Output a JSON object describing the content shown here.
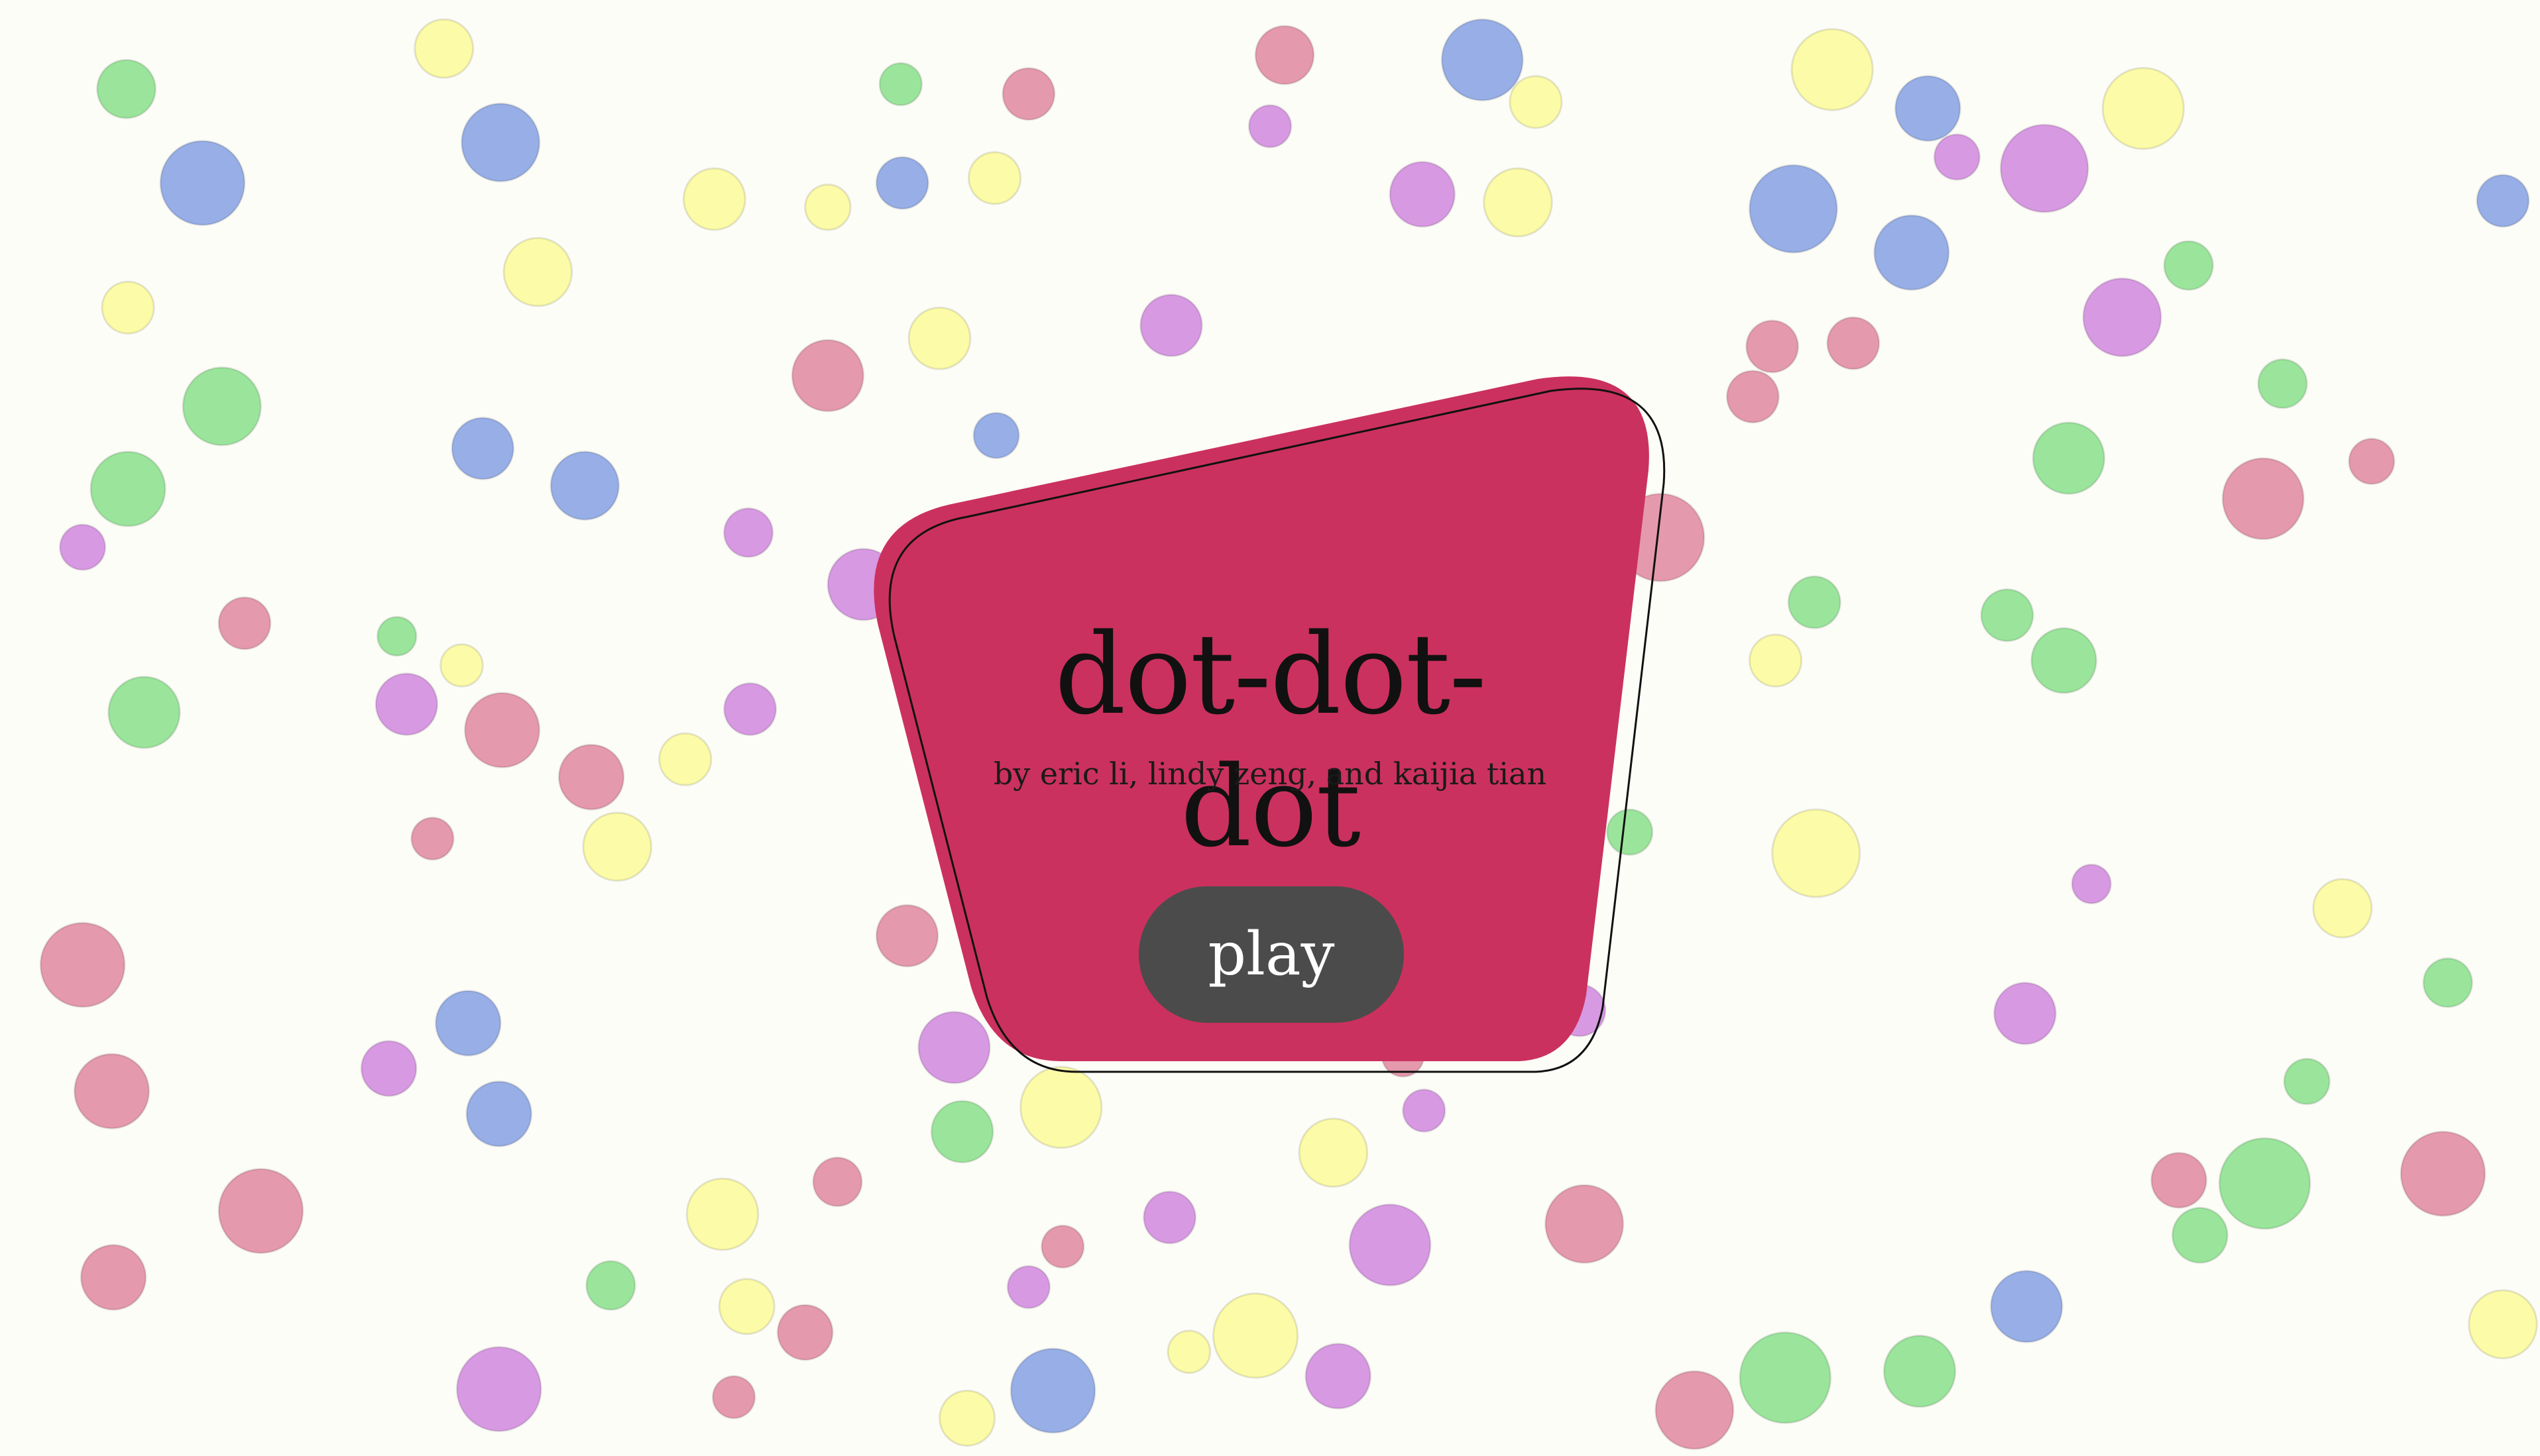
{
  "game": {
    "title": "dot-dot-dot",
    "credits": "by eric li, lindy zeng, and kaijia tian",
    "play_label": "play"
  },
  "colors": {
    "background": "#fdfdf8",
    "card": "#cb315e",
    "card_outline": "#111111",
    "button": "#4b4b4b",
    "button_text": "#ffffff",
    "dot_palette": {
      "pink": "#e599ad",
      "blue": "#97aee6",
      "green": "#9ae59b",
      "yellow": "#fcfba8",
      "purple": "#d899e3"
    }
  }
}
